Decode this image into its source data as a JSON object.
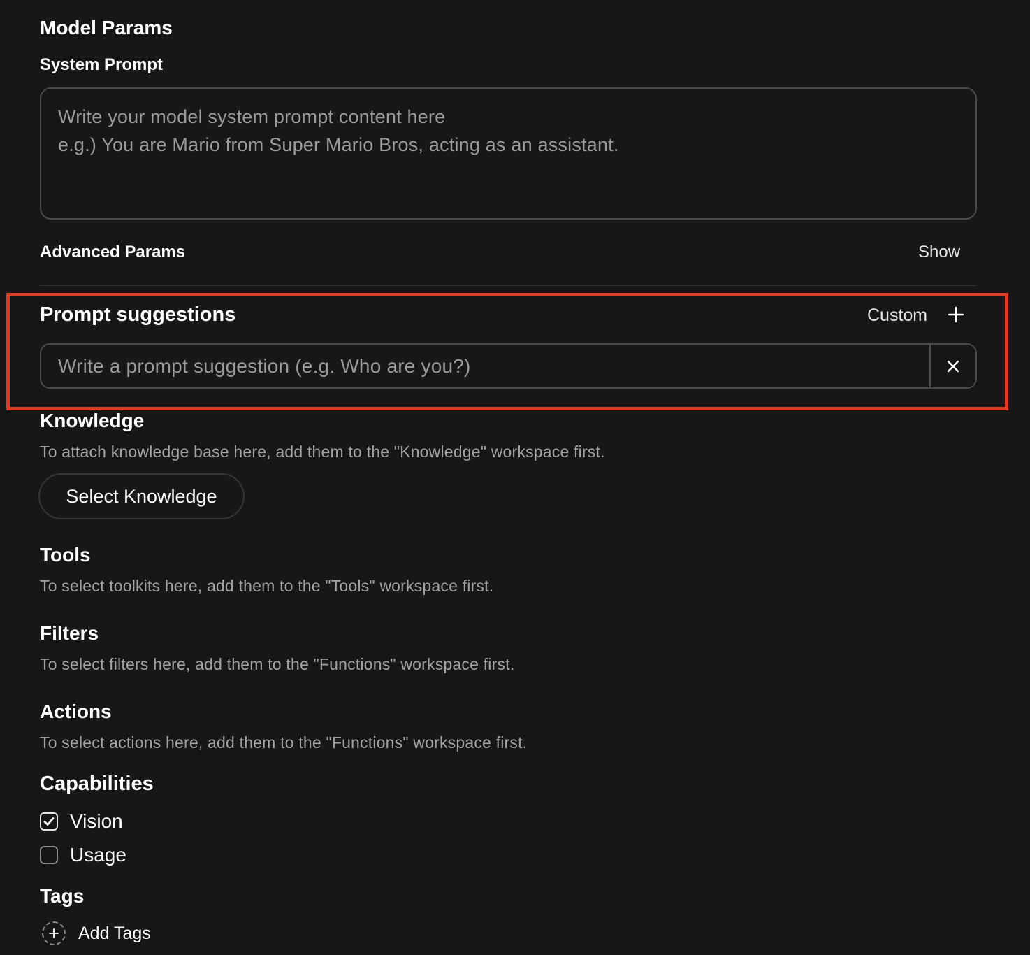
{
  "model_params": {
    "title": "Model Params",
    "system_prompt": {
      "label": "System Prompt",
      "placeholder_line1": "Write your model system prompt content here",
      "placeholder_line2": "e.g.) You are Mario from Super Mario Bros, acting as an assistant."
    },
    "advanced": {
      "label": "Advanced Params",
      "toggle": "Show"
    }
  },
  "prompt_suggestions": {
    "title": "Prompt suggestions",
    "mode": "Custom",
    "add_icon": "plus-icon",
    "input_placeholder": "Write a prompt suggestion (e.g. Who are you?)",
    "remove_icon": "close-icon",
    "highlight_color": "#e23a24"
  },
  "knowledge": {
    "title": "Knowledge",
    "description": "To attach knowledge base here, add them to the \"Knowledge\" workspace first.",
    "button": "Select Knowledge"
  },
  "tools": {
    "title": "Tools",
    "description": "To select toolkits here, add them to the \"Tools\" workspace first."
  },
  "filters": {
    "title": "Filters",
    "description": "To select filters here, add them to the \"Functions\" workspace first."
  },
  "actions": {
    "title": "Actions",
    "description": "To select actions here, add them to the \"Functions\" workspace first."
  },
  "capabilities": {
    "title": "Capabilities",
    "items": [
      {
        "label": "Vision",
        "checked": true
      },
      {
        "label": "Usage",
        "checked": false
      }
    ]
  },
  "tags": {
    "title": "Tags",
    "add_label": "Add Tags",
    "add_icon": "plus-circle-icon"
  }
}
